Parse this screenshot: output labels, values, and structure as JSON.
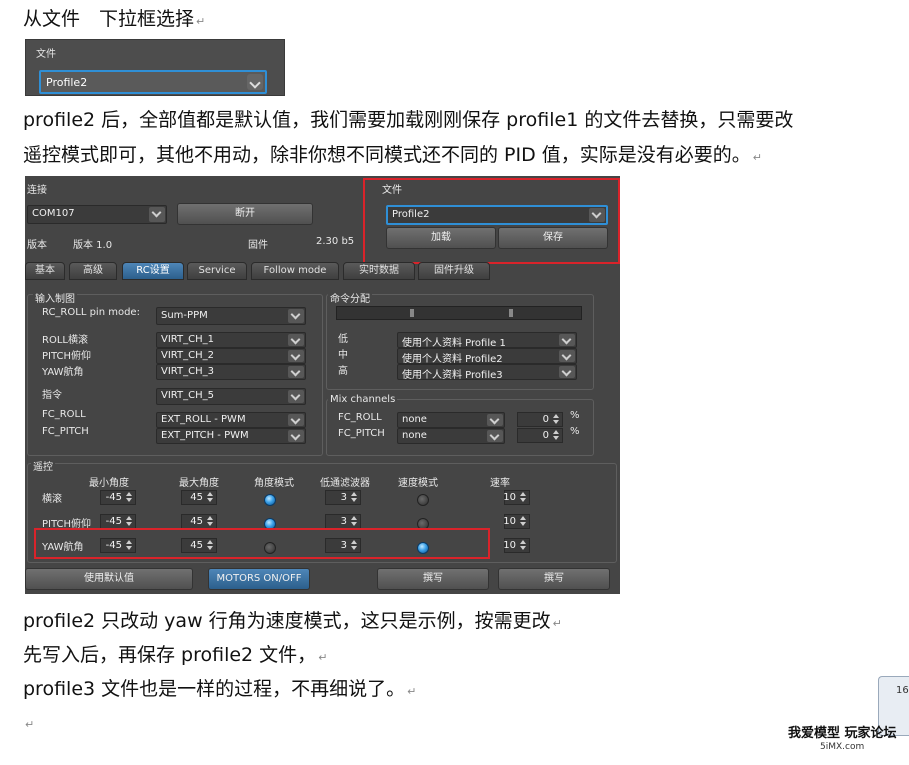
{
  "doc": {
    "heading": "从文件　下拉框选择",
    "para1_line1": "profile2 后，全部值都是默认值，我们需要加载刚刚保存 profile1 的文件去替换，只需要改",
    "para1_line2": "遥控模式即可，其他不用动，除非你想不同模式还不同的 PID 值，实际是没有必要的。",
    "para2": "profile2 只改动 yaw 行角为速度模式，这只是示例，按需更改",
    "para3": "先写入后，再保存 profile2 文件，",
    "para4": "profile3 文件也是一样的过程，不再细说了。",
    "mark": "↵"
  },
  "mini": {
    "label": "文件",
    "value": "Profile2"
  },
  "app": {
    "connection_label": "连接",
    "port_value": "COM107",
    "disconnect_label": "断开",
    "version_label": "版本",
    "version_value": "版本 1.0",
    "firmware_label": "固件",
    "firmware_value": "2.30 b5",
    "file_label": "文件",
    "file_value": "Profile2",
    "load_label": "加载",
    "save_label": "保存",
    "tabs": [
      "基本",
      "高级",
      "RC设置",
      "Service",
      "Follow mode",
      "实时数据",
      "固件升级"
    ],
    "input_map_title": "输入制图",
    "rc_roll_mode_label": "RC_ROLL pin mode:",
    "rc_roll_mode_value": "Sum-PPM",
    "roll_label": "ROLL横滚",
    "pitch_label": "PITCH俯仰",
    "yaw_label": "YAW航角",
    "roll_value": "VIRT_CH_1",
    "pitch_value": "VIRT_CH_2",
    "yaw_value": "VIRT_CH_3",
    "cmd_label": "指令",
    "cmd_value": "VIRT_CH_5",
    "fc_roll_label": "FC_ROLL",
    "fc_pitch_label": "FC_PITCH",
    "fc_roll_value": "EXT_ROLL - PWM",
    "fc_pitch_value": "EXT_PITCH - PWM",
    "cmd_assign_title": "命令分配",
    "low_label": "低",
    "mid_label": "中",
    "high_label": "高",
    "low_value": "使用个人资料 Profile 1",
    "mid_value": "使用个人资料 Profile2",
    "high_value": "使用个人资料 Profile3",
    "mix_title": "Mix channels",
    "mix_fc_roll_label": "FC_ROLL",
    "mix_fc_pitch_label": "FC_PITCH",
    "mix_roll_value": "none",
    "mix_pitch_value": "none",
    "mix_roll_pct": "0",
    "mix_pitch_pct": "0",
    "pct": "%",
    "rc_title": "遥控",
    "col_min": "最小角度",
    "col_max": "最大角度",
    "col_angle": "角度模式",
    "col_lpf": "低通滤波器",
    "col_speed": "速度模式",
    "col_rate": "速率",
    "rows": [
      {
        "label": "横滚",
        "min": "-45",
        "max": "45",
        "lpf": "3",
        "rate": "10",
        "angle": true,
        "speed": false
      },
      {
        "label": "PITCH俯仰",
        "min": "-45",
        "max": "45",
        "lpf": "3",
        "rate": "10",
        "angle": true,
        "speed": false
      },
      {
        "label": "YAW航角",
        "min": "-45",
        "max": "45",
        "lpf": "3",
        "rate": "10",
        "angle": false,
        "speed": true
      }
    ],
    "use_defaults_label": "使用默认值",
    "motors_label": "MOTORS ON/OFF",
    "write_label": "撰写",
    "write2_label": "撰写"
  },
  "watermark": {
    "line1": "我爱模型 玩家论坛",
    "line2": "5iMX.com"
  },
  "side_widget": {
    "text": "16"
  },
  "colors": {
    "highlight_red": "#d9232a",
    "accent_blue": "#2f8fd6",
    "panel_bg": "#454545"
  }
}
